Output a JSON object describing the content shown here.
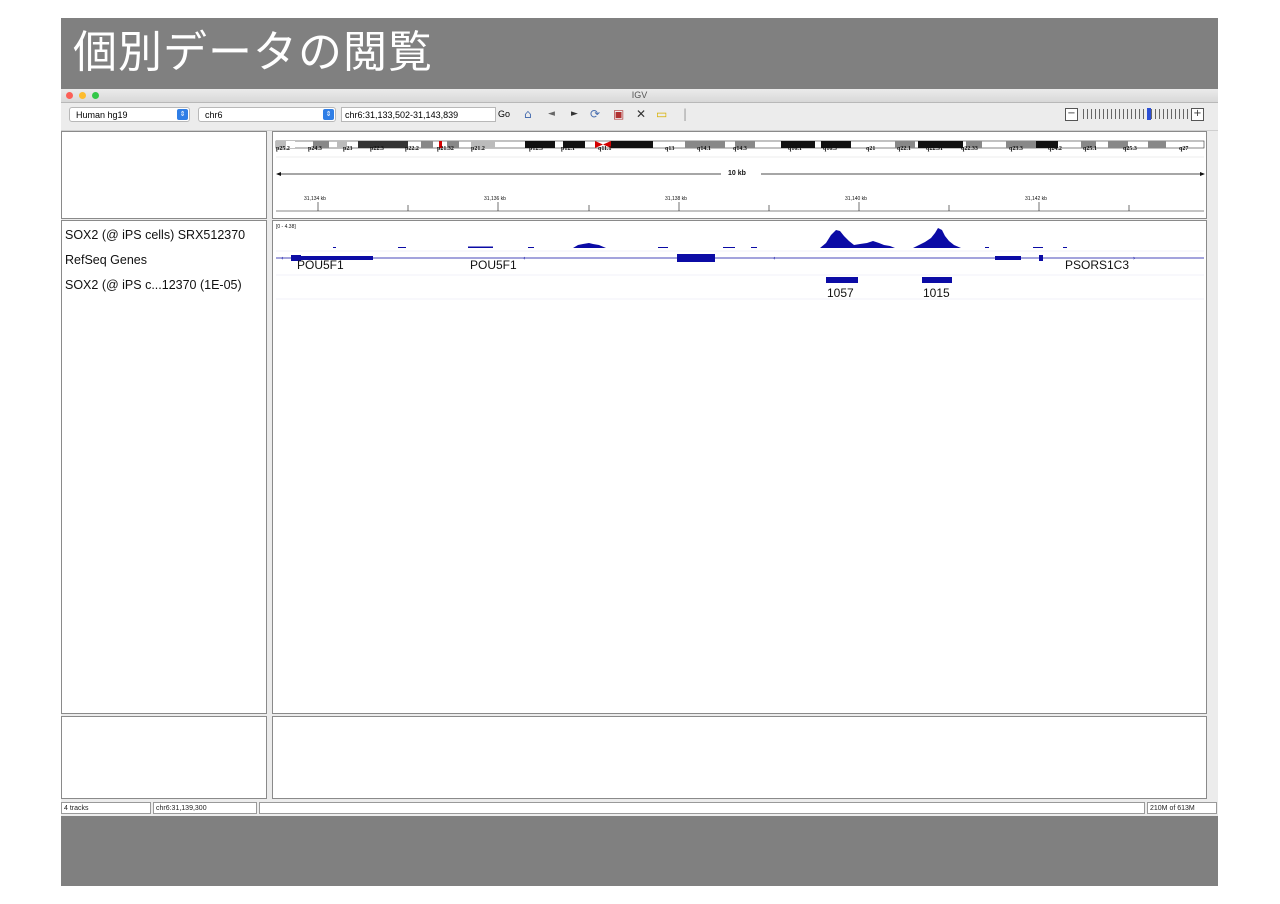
{
  "slide": {
    "title": "個別データの閲覧"
  },
  "window": {
    "title": "IGV"
  },
  "toolbar": {
    "genome": "Human hg19",
    "chromosome": "chr6",
    "locus": "chr6:31,133,502-31,143,839",
    "go_label": "Go"
  },
  "ruler": {
    "scale_label": "10 kb",
    "ticks": [
      "31,134 kb",
      "31,136 kb",
      "31,138 kb",
      "31,140 kb",
      "31,142 kb"
    ]
  },
  "ideogram": {
    "bands": [
      "p25.2",
      "p24.3",
      "p23",
      "p22.3",
      "p22.2",
      "p21.32",
      "p21.2",
      "p12.3",
      "p12.1",
      "q11.1",
      "q13",
      "q14.1",
      "q14.3",
      "q16.1",
      "q16.3",
      "q21",
      "q22.1",
      "q22.31",
      "q22.33",
      "q23.3",
      "q24.2",
      "q25.1",
      "q25.3",
      "q27"
    ]
  },
  "tracks": {
    "names": [
      "SOX2 (@ iPS cells) SRX512370",
      "RefSeq Genes",
      "SOX2 (@ iPS c...12370 (1E-05)"
    ],
    "data_range": "[0 - 4.38]",
    "genes": [
      "POU5F1",
      "POU5F1",
      "PSORS1C3"
    ],
    "peaks": [
      "1057",
      "1015"
    ]
  },
  "status": {
    "tracks": "4 tracks",
    "position": "chr6:31,139,300",
    "memory": "210M of 613M"
  },
  "colors": {
    "signal": "#0b0ba5",
    "slide_bg": "#808080",
    "centromere": "#d40000"
  }
}
